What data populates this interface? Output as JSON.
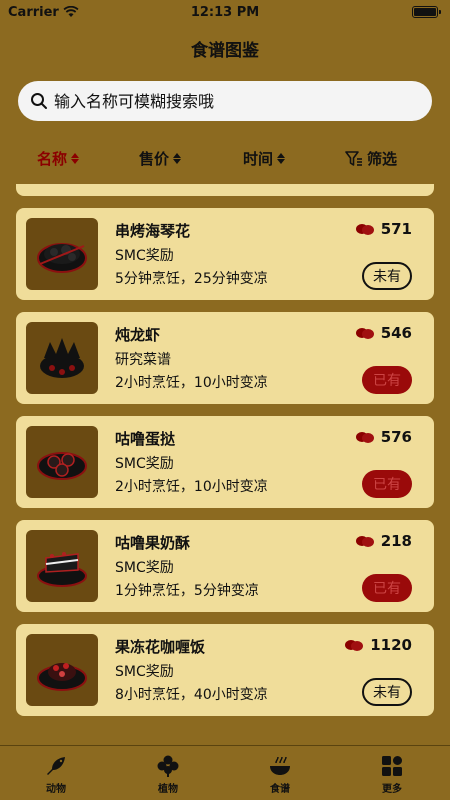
{
  "status_bar": {
    "carrier": "Carrier",
    "time": "12:13 PM"
  },
  "nav": {
    "title": "食谱图鉴"
  },
  "search": {
    "placeholder": "输入名称可模糊搜索哦"
  },
  "sort": {
    "name": "名称",
    "price": "售价",
    "time": "时间",
    "filter": "筛选"
  },
  "recipes": [
    {
      "name": "串烤海琴花",
      "source": "SMC奖励",
      "time": "5分钟烹饪，25分钟变凉",
      "price": "571",
      "status": "未有"
    },
    {
      "name": "炖龙虾",
      "source": "研究菜谱",
      "time": "2小时烹饪，10小时变凉",
      "price": "546",
      "status": "已有"
    },
    {
      "name": "咕噜蛋挞",
      "source": "SMC奖励",
      "time": "2小时烹饪，10小时变凉",
      "price": "576",
      "status": "已有"
    },
    {
      "name": "咕噜果奶酥",
      "source": "SMC奖励",
      "time": "1分钟烹饪，5分钟变凉",
      "price": "218",
      "status": "已有"
    },
    {
      "name": "果冻花咖喱饭",
      "source": "SMC奖励",
      "time": "8小时烹饪，40小时变凉",
      "price": "1120",
      "status": "未有"
    }
  ],
  "tabs": [
    {
      "label": "动物",
      "icon": "fish-icon"
    },
    {
      "label": "植物",
      "icon": "clover-icon"
    },
    {
      "label": "食谱",
      "icon": "bowl-icon"
    },
    {
      "label": "更多",
      "icon": "grid-icon"
    }
  ],
  "colors": {
    "background": "#8c6a20",
    "card": "#f0dd9a",
    "accent": "#8b0000",
    "owned_button": "#9a0a0a"
  }
}
